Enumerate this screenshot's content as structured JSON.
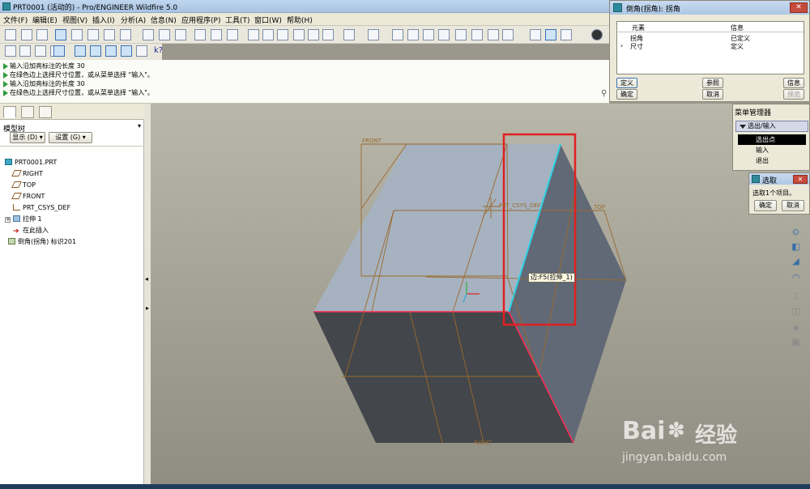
{
  "window": {
    "title": "PRT0001 (活动的) - Pro/ENGINEER Wildfire 5.0"
  },
  "menubar": [
    "文件(F)",
    "编辑(E)",
    "视图(V)",
    "插入(I)",
    "分析(A)",
    "信息(N)",
    "应用程序(P)",
    "工具(T)",
    "窗口(W)",
    "帮助(H)"
  ],
  "messages": [
    "输入沿加亮标注的长度   30",
    "在绿色边上选择尺寸位置，或从菜单选择 \"输入\"。",
    "输入沿加亮标注的长度   30",
    "在绿色边上选择尺寸位置，或从菜单选择 \"输入\"。"
  ],
  "model_tree": {
    "label": "模型树",
    "show_btn": "显示 (D) ▾",
    "settings_btn": "设置 (G) ▾",
    "items": [
      "PRT0001.PRT",
      "RIGHT",
      "TOP",
      "FRONT",
      "PRT_CSYS_DEF",
      "拉伸 1",
      "在此插入",
      "倒角(拐角) 标识201"
    ]
  },
  "viewport": {
    "labels": {
      "front": "FRONT",
      "top": "TOP",
      "right": "RIGHT",
      "csys": "PRT_CSYS_DEF"
    },
    "tooltip": "边:F5(拉伸_1)",
    "highlight_color": "#e02020",
    "edge_red": "#ff2d55",
    "edge_cyan": "#2fd3e8"
  },
  "dialog": {
    "title": "倒角(拐角): 拐角",
    "close": "✕",
    "col_element": "元素",
    "col_info": "信息",
    "rows": [
      {
        "element": "拐角",
        "info": "已定义"
      },
      {
        "element": "尺寸",
        "info": "定义"
      }
    ],
    "btn_define": "定义",
    "btn_ref": "参照",
    "btn_info": "信息",
    "btn_ok": "确定",
    "btn_cancel": "取消",
    "btn_preview": "预览"
  },
  "menu_manager": {
    "title": "菜单管理器",
    "header": "选出/输入",
    "items": [
      "选出点",
      "输入",
      "退出"
    ]
  },
  "select_dialog": {
    "title": "选取",
    "close": "✕",
    "text": "选取1个项目。",
    "ok": "确定",
    "cancel": "取消"
  },
  "watermark": {
    "brand": "Bai",
    "brand2": "经验",
    "url": "jingyan.baidu.com"
  }
}
